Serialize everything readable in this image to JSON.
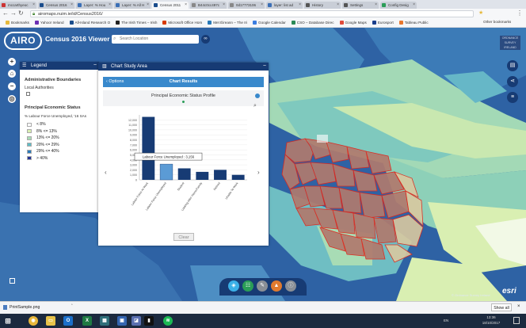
{
  "browser": {
    "tabs": [
      {
        "label": "mccarthyeoc",
        "color": "#c33"
      },
      {
        "label": "Census 2016",
        "color": "#1b4d8c"
      },
      {
        "label": "Layer: % Hou",
        "color": "#3b6fb6"
      },
      {
        "label": "Layer: % All H",
        "color": "#3b6fb6"
      },
      {
        "label": "Census 2011",
        "color": "#1b4d8c",
        "active": true
      },
      {
        "label": "B44c0cc497c",
        "color": "#888"
      },
      {
        "label": "0d17773106",
        "color": "#888"
      },
      {
        "label": "layer: list ad",
        "color": "#3b6fb6"
      },
      {
        "label": "History",
        "color": "#555"
      },
      {
        "label": "Settings",
        "color": "#555"
      },
      {
        "label": "Config Desig",
        "color": "#2a9d57"
      }
    ],
    "url": "airomaps.nuim.ie/id/Census2016/",
    "bookmarks": [
      {
        "label": "Bookmarks",
        "color": "#e6b93c"
      },
      {
        "label": "Yahoo! Ireland",
        "color": "#6b2fb3"
      },
      {
        "label": "All-Island Research O",
        "color": "#1b4d8c"
      },
      {
        "label": "The Irish Times – Irish",
        "color": "#222"
      },
      {
        "label": "Microsoft Office Hom",
        "color": "#d83b01"
      },
      {
        "label": "Met Éireann – The Iri",
        "color": "#2a7ab8"
      },
      {
        "label": "Google Calendar",
        "color": "#3b7de0"
      },
      {
        "label": "CSO – Database Direc",
        "color": "#2b8a56"
      },
      {
        "label": "Google Maps",
        "color": "#e04b3b"
      },
      {
        "label": "Eurosport",
        "color": "#1b3f8c"
      },
      {
        "label": "Tableau Public",
        "color": "#e8772e"
      }
    ],
    "other_bookmarks": "Other bookmarks"
  },
  "app": {
    "logo": "AIRO",
    "title": "Census 2016 Viewer",
    "search_placeholder": "Search Location",
    "ire_logo": "ORDNANCE SURVEY IRELAND"
  },
  "legend": {
    "title": "Legend",
    "admin_heading": "Administrative Boundaries",
    "local_authorities": "Local Authorities",
    "pes_heading": "Principal Economic Status",
    "layer_label": "% Labour Force Unemployed, '16 SAs",
    "classes": [
      {
        "label": "< 8%",
        "color": "#ffffff"
      },
      {
        "label": "8% <= 13%",
        "color": "#d9efb2"
      },
      {
        "label": "13% <= 20%",
        "color": "#a8dcb5"
      },
      {
        "label": "20% <= 29%",
        "color": "#5fbcc6"
      },
      {
        "label": "29% <= 40%",
        "color": "#2b7bba"
      },
      {
        "label": "> 40%",
        "color": "#253494"
      }
    ]
  },
  "chart_panel": {
    "title": "Chart Study Area",
    "options_label": "Options",
    "results_title": "Chart Results",
    "clear_label": "Clear",
    "tooltip": "Labour Force Unemployed : 3,156"
  },
  "chart_data": {
    "type": "bar",
    "title": "Principal Economic Status Profile",
    "categories": [
      "Labour Force At Work",
      "Labour Force Unemployed",
      "Student",
      "Looking After Home/Family",
      "Retired",
      "Unable To Work"
    ],
    "values": [
      12600,
      3156,
      2300,
      1600,
      2000,
      1000
    ],
    "ylim": [
      0,
      13000
    ],
    "yticks": [
      0,
      1000,
      2000,
      3000,
      4000,
      5000,
      6000,
      7000,
      8000,
      9000,
      10000,
      11000,
      12000
    ],
    "highlight_index": 1,
    "colors": {
      "bar": "#173b74",
      "highlight": "#5b9bd5"
    }
  },
  "map": {
    "credit": "© Ordnance Survey Ireland",
    "esri": "esri"
  },
  "downloads": {
    "file": "PrintSample.png",
    "show_all": "Show all"
  },
  "taskbar": {
    "time": "13:36",
    "date": "18/10/2017",
    "lang": "EN"
  }
}
